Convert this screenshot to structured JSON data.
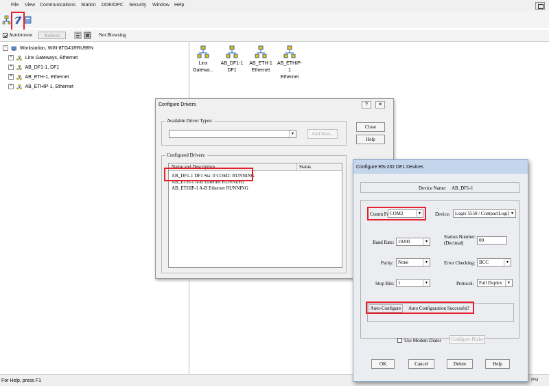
{
  "menu": [
    "File",
    "View",
    "Communications",
    "Station",
    "DDE/OPC",
    "Security",
    "Window",
    "Help"
  ],
  "toolbar2": {
    "autobrowse_label": "Autobrowse",
    "refresh_label": "Refresh",
    "status_label": "Not Browsing"
  },
  "tree": {
    "root": "Workstation, WIN-8TG41RRU9RN",
    "children": [
      "Linx Gateways, Ethernet",
      "AB_DF1-1, DF1",
      "AB_ETH-1, Ethernet",
      "AB_ETHIP-1, Ethernet"
    ]
  },
  "devices": [
    {
      "line1": "Linx",
      "line2": "Gatewa..."
    },
    {
      "line1": "AB_DF1-1",
      "line2": "DF1"
    },
    {
      "line1": "AB_ETH-1",
      "line2": "Ethernet"
    },
    {
      "line1": "AB_ETHIP-1",
      "line2": "Ethernet"
    }
  ],
  "status_bar": {
    "left": "For Help, press F1",
    "time": "PM"
  },
  "configure_drivers": {
    "title": "Configure Drivers",
    "help_glyph": "?",
    "close_glyph": "✕",
    "available_label": "Available Driver Types:",
    "add_new_label": "Add New...",
    "close_label": "Close",
    "help_label": "Help",
    "configured_label": "Configured Drivers:",
    "col_name": "Name and Description",
    "col_status": "Status",
    "drivers": [
      "AB_DF1-1 DF1 Sta: 0 COM2: RUNNING",
      "AB_ETH-1 A-B Ethernet RUNNING",
      "AB_ETHIP-1 A-B Ethernet RUNNING"
    ]
  },
  "rs232": {
    "title": "Configure RS-232 DF1 Devices",
    "device_name_label": "Device Name:",
    "device_name": "AB_DF1-1",
    "comm_label": "Comm Port:",
    "comm_value": "COM2",
    "device_label": "Device:",
    "device_value": "Logix 5550 / CompactLogix",
    "baud_label": "Baud Rate:",
    "baud_value": "19200",
    "station_label_1": "Station Number:",
    "station_label_2": "(Decimal)",
    "station_value": "00",
    "parity_label": "Parity:",
    "parity_value": "None",
    "error_label": "Error Checking:",
    "error_value": "BCC",
    "stop_label": "Stop Bits:",
    "stop_value": "1",
    "protocol_label": "Protocol:",
    "protocol_value": "Full Duplex",
    "autoconfig_label": "Auto-Configure",
    "autoconfig_status": "Auto Configuration Successful!",
    "modem_label": "Use Modem Dialer",
    "configure_dialer_label": "Configure Dialer",
    "ok_label": "OK",
    "cancel_label": "Cancel",
    "delete_label": "Delete",
    "help_label": "Help"
  },
  "colors": {
    "highlight": "#e5202e",
    "device_icon": "#f2c200",
    "device_icon_stroke": "#2d5fa8"
  }
}
